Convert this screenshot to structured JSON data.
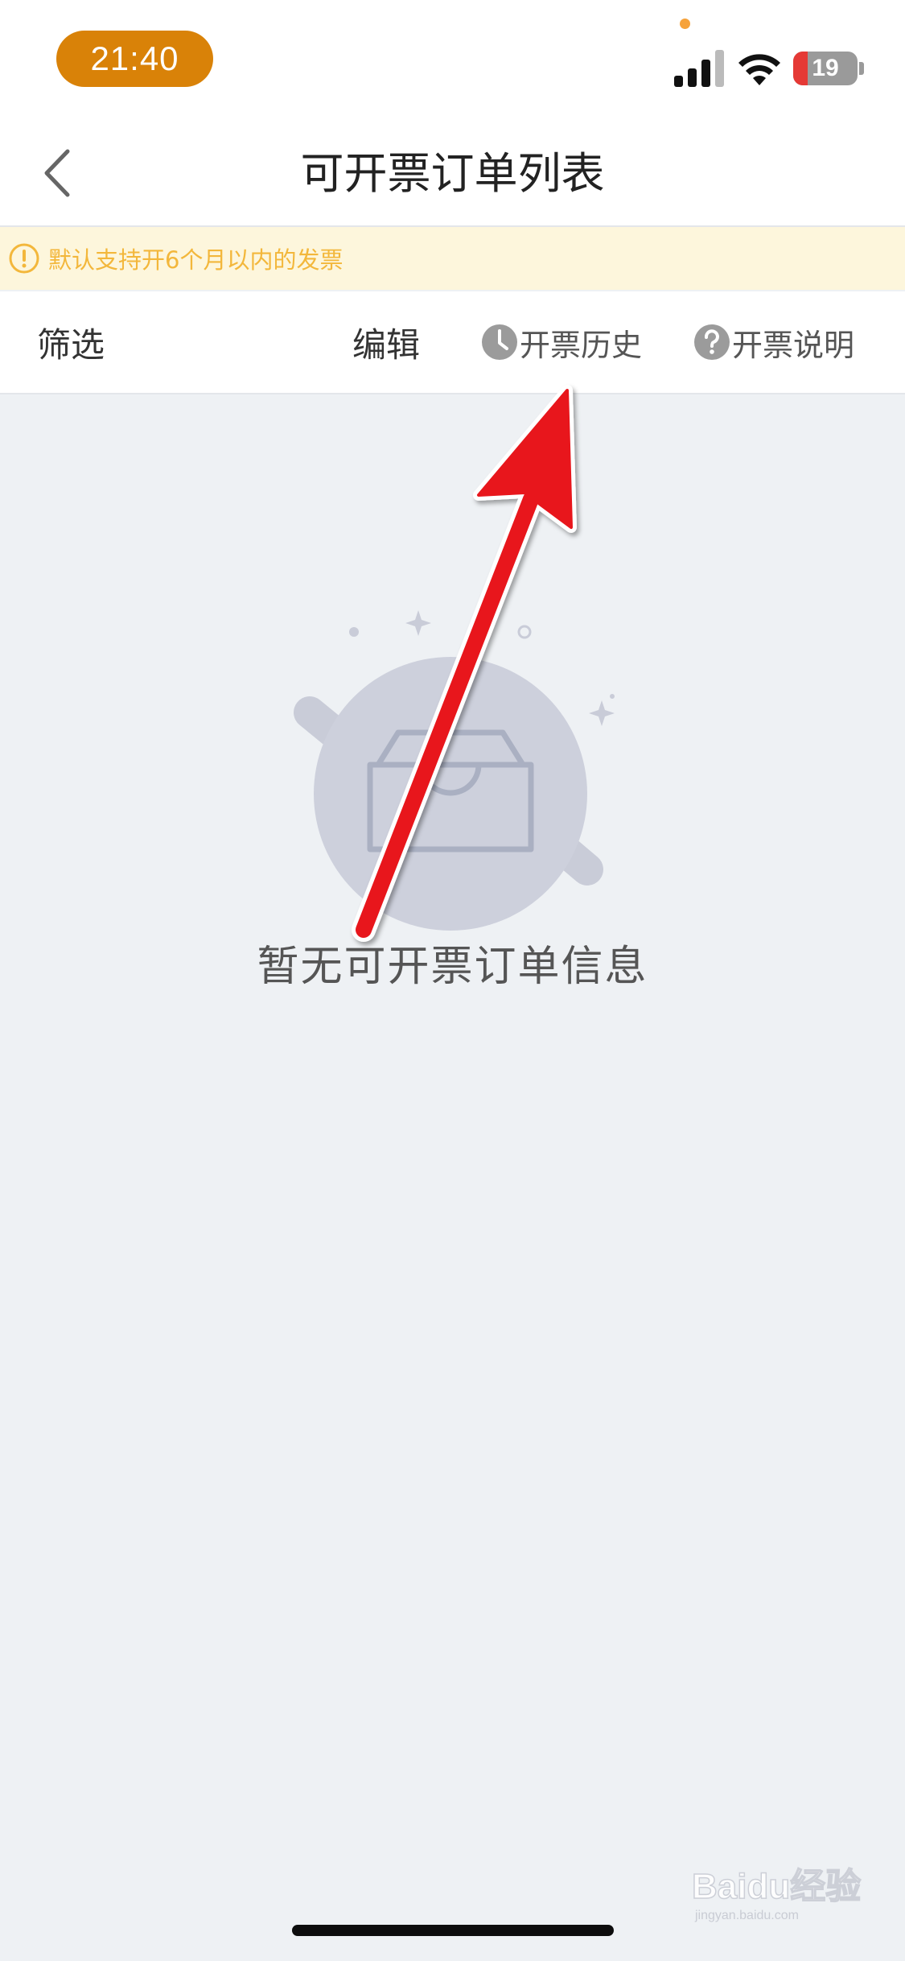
{
  "status_bar": {
    "time": "21:40",
    "battery_level": "19",
    "icons": [
      "signal-icon",
      "wifi-icon",
      "battery-icon"
    ],
    "accent_color": "#d98208"
  },
  "nav": {
    "title": "可开票订单列表",
    "back_icon": "chevron-left-icon"
  },
  "notice": {
    "text": "默认支持开6个月以内的发票",
    "icon": "warning-circle-icon",
    "color": "#f3b73b"
  },
  "toolbar": {
    "filter_label": "筛选",
    "edit_label": "编辑",
    "history_label": "开票历史",
    "history_icon": "clock-icon",
    "help_label": "开票说明",
    "help_icon": "question-circle-icon"
  },
  "empty_state": {
    "message": "暂无可开票订单信息",
    "illustration": "empty-inbox-icon"
  },
  "annotation": {
    "arrow_color": "#e8141b",
    "arrow": "red-arrow-icon"
  },
  "watermark": {
    "text": "Baidu经验",
    "subtext": "jingyan.baidu.com"
  }
}
